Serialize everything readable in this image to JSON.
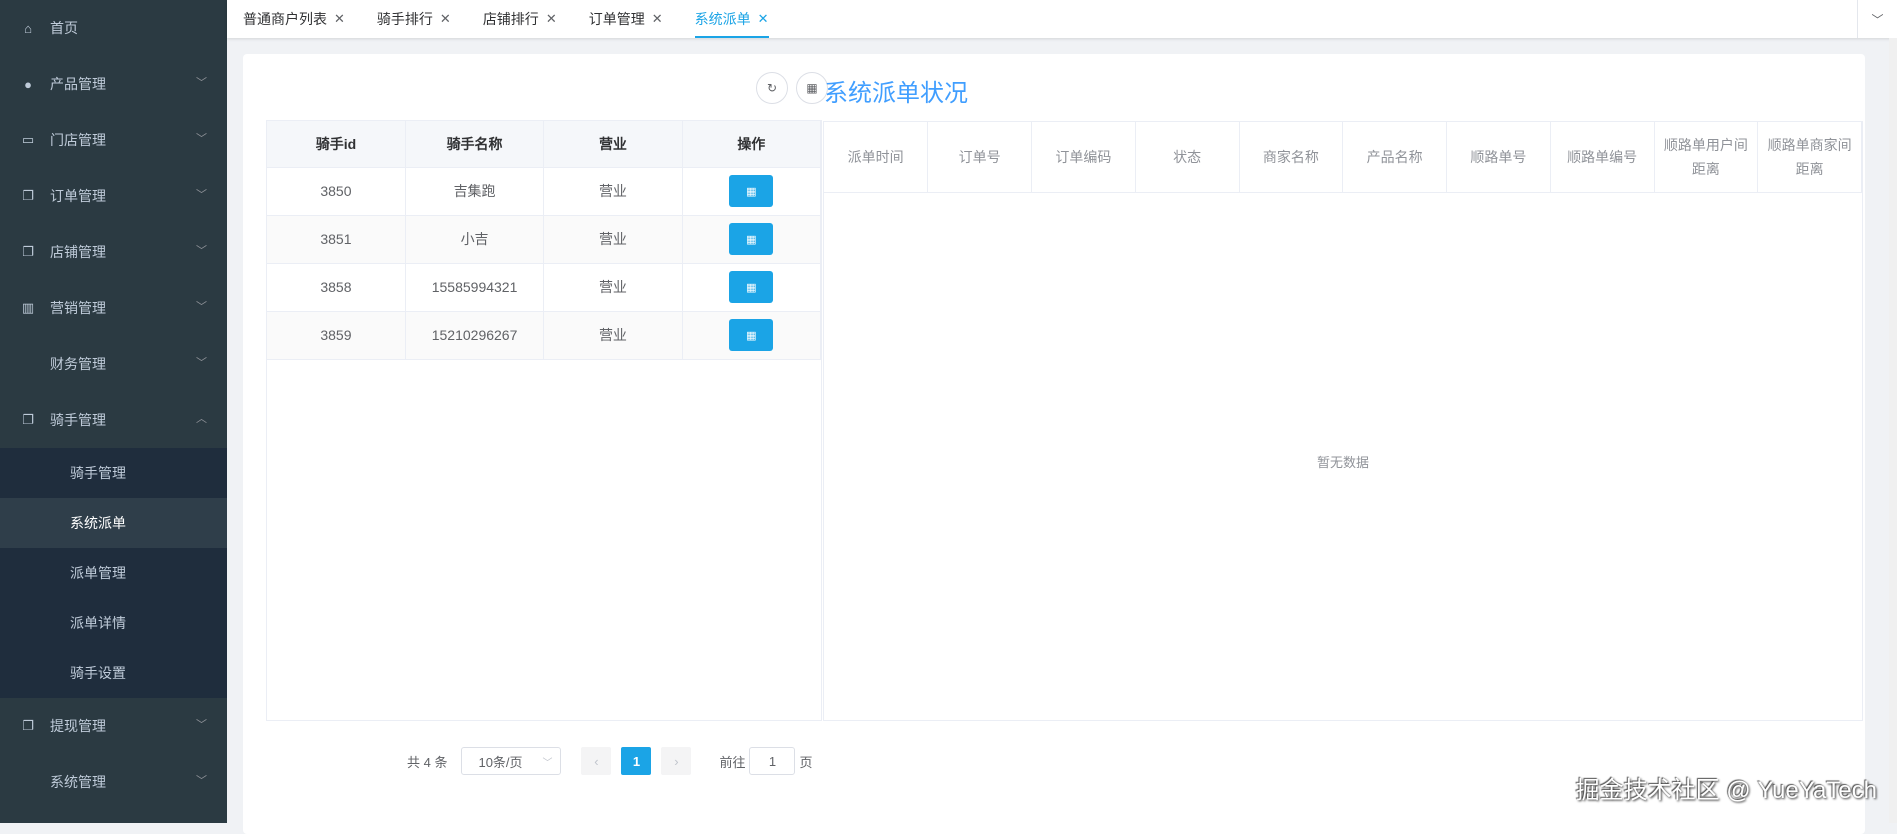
{
  "sidebar": {
    "items": [
      {
        "label": "首页",
        "icon": "home-icon"
      },
      {
        "label": "产品管理",
        "icon": "user-icon"
      },
      {
        "label": "门店管理",
        "icon": "store-icon"
      },
      {
        "label": "订单管理",
        "icon": "document-icon"
      },
      {
        "label": "店铺管理",
        "icon": "document-icon"
      },
      {
        "label": "营销管理",
        "icon": "bar-chart-icon"
      },
      {
        "label": "财务管理",
        "icon": ""
      },
      {
        "label": "骑手管理",
        "icon": "document-icon"
      },
      {
        "label": "提现管理",
        "icon": "document-icon"
      },
      {
        "label": "系统管理",
        "icon": ""
      }
    ],
    "rider_sub": [
      "骑手管理",
      "系统派单",
      "派单管理",
      "派单详情",
      "骑手设置"
    ]
  },
  "tabs": [
    "普通商户列表",
    "骑手排行",
    "店铺排行",
    "订单管理",
    "系统派单"
  ],
  "title": "系统派单状况",
  "left_table": {
    "headers": [
      "骑手id",
      "骑手名称",
      "营业",
      "操作"
    ],
    "rows": [
      [
        "3850",
        "吉集跑",
        "营业"
      ],
      [
        "3851",
        "小吉",
        "营业"
      ],
      [
        "3858",
        "15585994321",
        "营业"
      ],
      [
        "3859",
        "15210296267",
        "营业"
      ]
    ]
  },
  "right_table": {
    "headers": [
      "派单时间",
      "订单号",
      "订单编码",
      "状态",
      "商家名称",
      "产品名称",
      "顺路单号",
      "顺路单编号",
      "顺路单用户间距离",
      "顺路单商家间距离"
    ],
    "empty": "暂无数据"
  },
  "pager": {
    "total": "共 4 条",
    "size": "10条/页",
    "page": "1",
    "goto": "前往",
    "goto_value": "1",
    "page_unit": "页"
  },
  "watermark": "掘金技术社区 @ YueYaTech",
  "colors": {
    "accent": "#1ba4e6",
    "sidebar": "#2b3a42"
  }
}
